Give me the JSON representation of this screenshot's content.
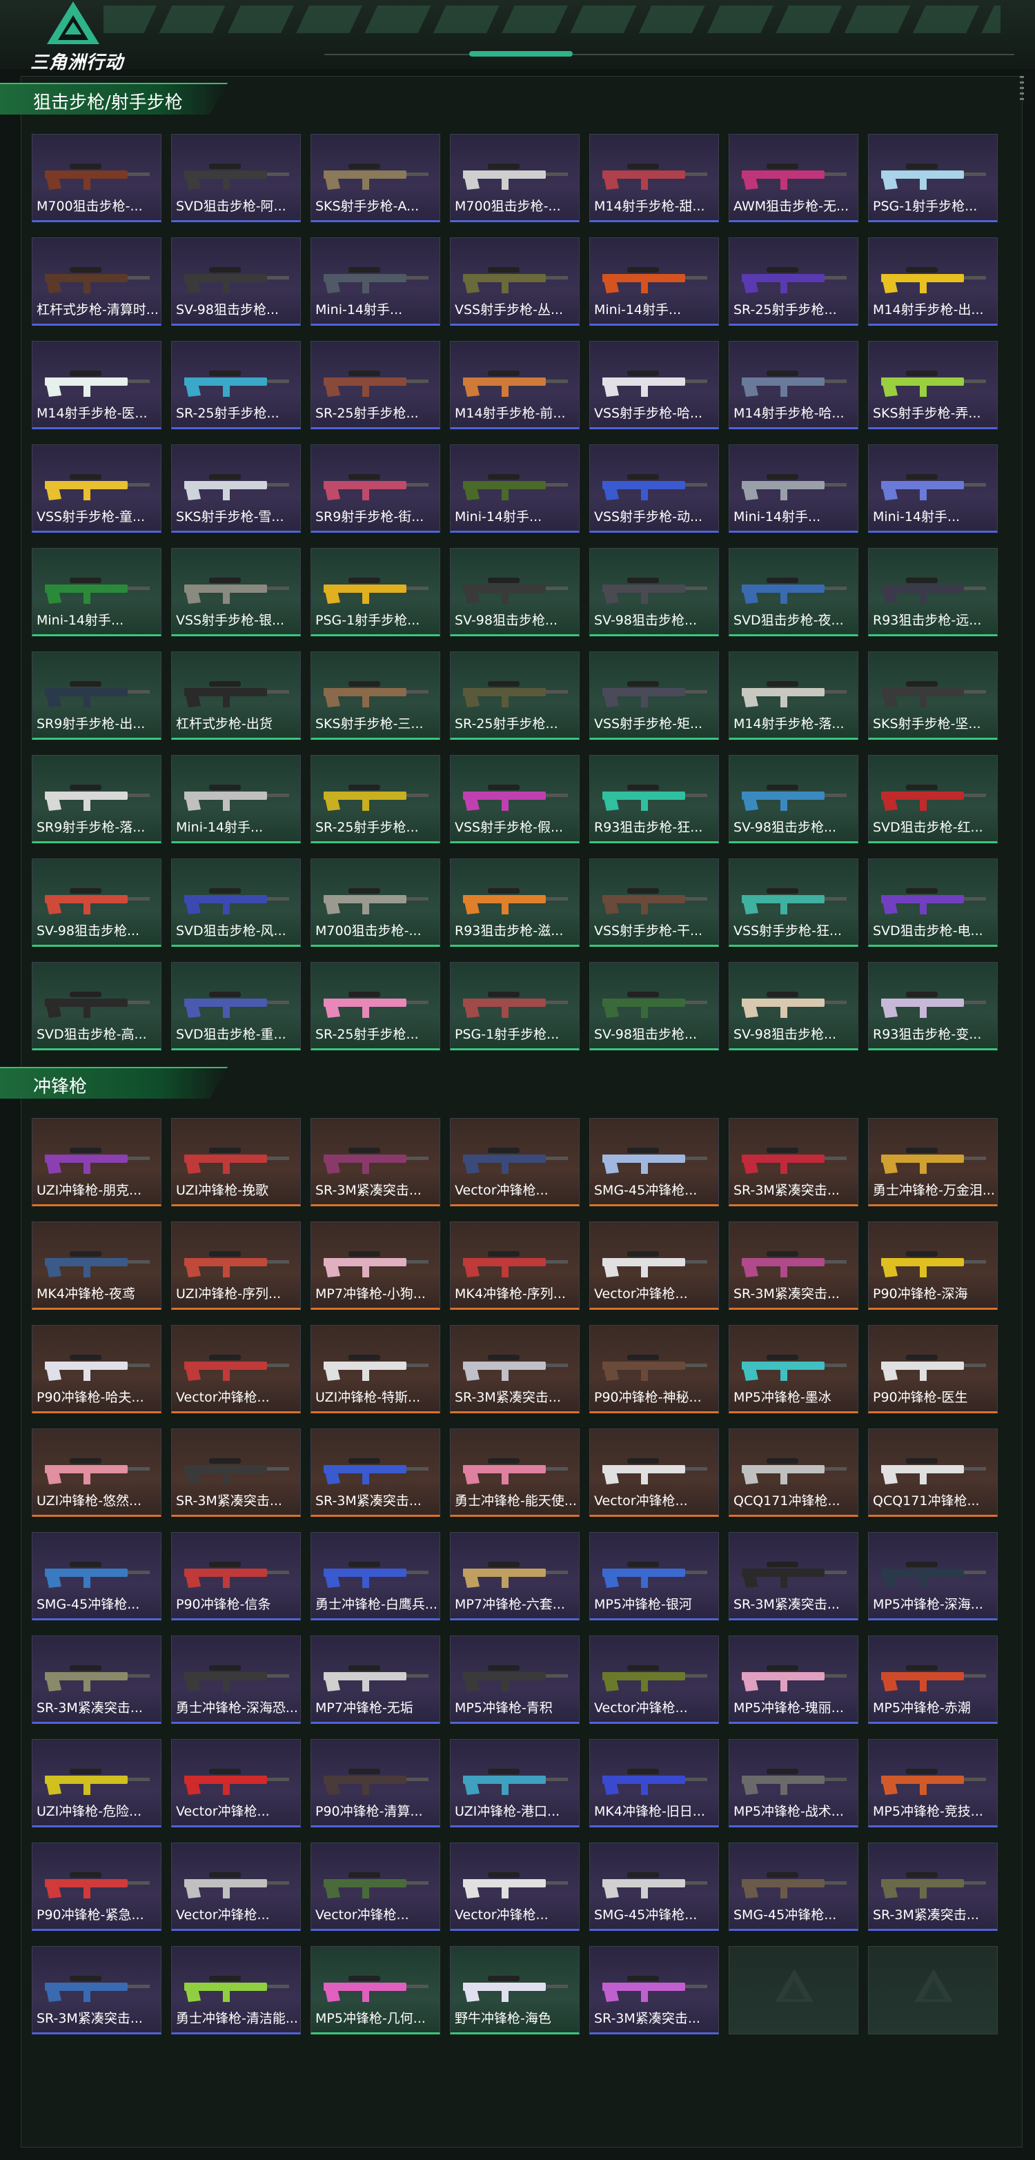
{
  "app": {
    "logo_text": "三角洲行动"
  },
  "sections": [
    {
      "title": "狙击步枪/射手步枪",
      "cards": [
        {
          "label": "M700狙击步枪-...",
          "rarity": "purple",
          "gun": "#7a3a26"
        },
        {
          "label": "SVD狙击步枪-阿...",
          "rarity": "purple",
          "gun": "#3c3c3c"
        },
        {
          "label": "SKS射手步枪-A...",
          "rarity": "purple",
          "gun": "#8a7a5a"
        },
        {
          "label": "M700狙击步枪-...",
          "rarity": "purple",
          "gun": "#cfcfcf"
        },
        {
          "label": "M14射手步枪-甜...",
          "rarity": "purple",
          "gun": "#b0404c"
        },
        {
          "label": "AWM狙击步枪-无...",
          "rarity": "purple",
          "gun": "#c0357a"
        },
        {
          "label": "PSG-1射手步枪...",
          "rarity": "purple",
          "gun": "#a8d3e8"
        },
        {
          "label": "杠杆式步枪-清算时...",
          "rarity": "purple",
          "gun": "#5c3a2a"
        },
        {
          "label": "SV-98狙击步枪...",
          "rarity": "purple",
          "gun": "#3a3a3a"
        },
        {
          "label": "Mini-14射手...",
          "rarity": "purple",
          "gun": "#505a66"
        },
        {
          "label": "VSS射手步枪-丛...",
          "rarity": "purple",
          "gun": "#6a6a3a"
        },
        {
          "label": "Mini-14射手...",
          "rarity": "purple",
          "gun": "#d4531f"
        },
        {
          "label": "SR-25射手步枪...",
          "rarity": "purple",
          "gun": "#5a3ab0"
        },
        {
          "label": "M14射手步枪-出...",
          "rarity": "purple",
          "gun": "#e8c020"
        },
        {
          "label": "M14射手步枪-医...",
          "rarity": "purple",
          "gun": "#e6f0ec"
        },
        {
          "label": "SR-25射手步枪...",
          "rarity": "purple",
          "gun": "#3aa8c8"
        },
        {
          "label": "SR-25射手步枪...",
          "rarity": "purple",
          "gun": "#8a4a3a"
        },
        {
          "label": "M14射手步枪-前...",
          "rarity": "purple",
          "gun": "#d07a3a"
        },
        {
          "label": "VSS射手步枪-哈...",
          "rarity": "purple",
          "gun": "#e0e0e6"
        },
        {
          "label": "M14射手步枪-哈...",
          "rarity": "purple",
          "gun": "#6a7a9a"
        },
        {
          "label": "SKS射手步枪-弄...",
          "rarity": "purple",
          "gun": "#9ad040"
        },
        {
          "label": "VSS射手步枪-童...",
          "rarity": "purple",
          "gun": "#e8c030"
        },
        {
          "label": "SKS射手步枪-雪...",
          "rarity": "purple",
          "gun": "#cfd4dc"
        },
        {
          "label": "SR9射手步枪-街...",
          "rarity": "purple",
          "gun": "#c04a6a"
        },
        {
          "label": "Mini-14射手...",
          "rarity": "purple",
          "gun": "#4a6a2a"
        },
        {
          "label": "VSS射手步枪-动...",
          "rarity": "purple",
          "gun": "#3a5ad0"
        },
        {
          "label": "Mini-14射手...",
          "rarity": "purple",
          "gun": "#9aa0aa"
        },
        {
          "label": "Mini-14射手...",
          "rarity": "purple",
          "gun": "#6a7ad8"
        },
        {
          "label": "Mini-14射手...",
          "rarity": "green",
          "gun": "#2a8a3a"
        },
        {
          "label": "VSS射手步枪-银...",
          "rarity": "green",
          "gun": "#8a8a80"
        },
        {
          "label": "PSG-1射手步枪...",
          "rarity": "green",
          "gun": "#e0b020"
        },
        {
          "label": "SV-98狙击步枪...",
          "rarity": "green",
          "gun": "#3a3a3a"
        },
        {
          "label": "SV-98狙击步枪...",
          "rarity": "green",
          "gun": "#4a4a52"
        },
        {
          "label": "SVD狙击步枪-夜...",
          "rarity": "green",
          "gun": "#3a6ab0"
        },
        {
          "label": "R93狙击步枪-远...",
          "rarity": "green",
          "gun": "#3a3a4a"
        },
        {
          "label": "SR9射手步枪-出...",
          "rarity": "green",
          "gun": "#2a3a4a"
        },
        {
          "label": "杠杆式步枪-出货",
          "rarity": "green",
          "gun": "#2a2a2a"
        },
        {
          "label": "SKS射手步枪-三...",
          "rarity": "green",
          "gun": "#8a6a4a"
        },
        {
          "label": "SR-25射手步枪...",
          "rarity": "green",
          "gun": "#5a5a3a"
        },
        {
          "label": "VSS射手步枪-矩...",
          "rarity": "green",
          "gun": "#4a4a5a"
        },
        {
          "label": "M14射手步枪-落...",
          "rarity": "green",
          "gun": "#c8c8c0"
        },
        {
          "label": "SKS射手步枪-坚...",
          "rarity": "green",
          "gun": "#3a3a3a"
        },
        {
          "label": "SR9射手步枪-落...",
          "rarity": "green",
          "gun": "#d8d8d8"
        },
        {
          "label": "Mini-14射手...",
          "rarity": "green",
          "gun": "#c0c0c0"
        },
        {
          "label": "SR-25射手步枪...",
          "rarity": "green",
          "gun": "#c8b020"
        },
        {
          "label": "VSS射手步枪-假...",
          "rarity": "green",
          "gun": "#c040b0"
        },
        {
          "label": "R93狙击步枪-狂...",
          "rarity": "green",
          "gun": "#30c0a0"
        },
        {
          "label": "SV-98狙击步枪...",
          "rarity": "green",
          "gun": "#3a8ac0"
        },
        {
          "label": "SVD狙击步枪-红...",
          "rarity": "green",
          "gun": "#c02a2a"
        },
        {
          "label": "SV-98狙击步枪...",
          "rarity": "green",
          "gun": "#d04a3a"
        },
        {
          "label": "SVD狙击步枪-风...",
          "rarity": "green",
          "gun": "#3a4ab0"
        },
        {
          "label": "M700狙击步枪-...",
          "rarity": "green",
          "gun": "#9a9a90"
        },
        {
          "label": "R93狙击步枪-滋...",
          "rarity": "green",
          "gun": "#e0802a"
        },
        {
          "label": "VSS射手步枪-干...",
          "rarity": "green",
          "gun": "#6a4a3a"
        },
        {
          "label": "VSS射手步枪-狂...",
          "rarity": "green",
          "gun": "#40b0a0"
        },
        {
          "label": "SVD狙击步枪-电...",
          "rarity": "green",
          "gun": "#7040c0"
        },
        {
          "label": "SVD狙击步枪-高...",
          "rarity": "green",
          "gun": "#2a2a2a"
        },
        {
          "label": "SVD狙击步枪-重...",
          "rarity": "green",
          "gun": "#4a5ab0"
        },
        {
          "label": "SR-25射手步枪...",
          "rarity": "green",
          "gun": "#e888b8"
        },
        {
          "label": "PSG-1射手步枪...",
          "rarity": "green",
          "gun": "#a04a4a"
        },
        {
          "label": "SV-98狙击步枪...",
          "rarity": "green",
          "gun": "#3a6a3a"
        },
        {
          "label": "SV-98狙击步枪...",
          "rarity": "green",
          "gun": "#d8c8b0"
        },
        {
          "label": "R93狙击步枪-变...",
          "rarity": "green",
          "gun": "#c8b8d8"
        }
      ]
    },
    {
      "title": "冲锋枪",
      "cards": [
        {
          "label": "UZI冲锋枪-朋克...",
          "rarity": "orange",
          "gun": "#8a40b0"
        },
        {
          "label": "UZI冲锋枪-挽歌",
          "rarity": "orange",
          "gun": "#c03a3a"
        },
        {
          "label": "SR-3M紧凑突击...",
          "rarity": "orange",
          "gun": "#8a3a6a"
        },
        {
          "label": "Vector冲锋枪...",
          "rarity": "orange",
          "gun": "#3a4a7a"
        },
        {
          "label": "SMG-45冲锋枪...",
          "rarity": "orange",
          "gun": "#a0b8e0"
        },
        {
          "label": "SR-3M紧凑突击...",
          "rarity": "orange",
          "gun": "#c02a3a"
        },
        {
          "label": "勇士冲锋枪-万金泪...",
          "rarity": "orange",
          "gun": "#d0a030"
        },
        {
          "label": "MK4冲锋枪-夜鸢",
          "rarity": "orange",
          "gun": "#3a5a8a"
        },
        {
          "label": "UZI冲锋枪-序列...",
          "rarity": "orange",
          "gun": "#c04a3a"
        },
        {
          "label": "MP7冲锋枪-小狗...",
          "rarity": "orange",
          "gun": "#e0b0c0"
        },
        {
          "label": "MK4冲锋枪-序列...",
          "rarity": "orange",
          "gun": "#c03a3a"
        },
        {
          "label": "Vector冲锋枪...",
          "rarity": "orange",
          "gun": "#e0e0e0"
        },
        {
          "label": "SR-3M紧凑突击...",
          "rarity": "orange",
          "gun": "#b04a8a"
        },
        {
          "label": "P90冲锋枪-深海",
          "rarity": "orange",
          "gun": "#e0c020"
        },
        {
          "label": "P90冲锋枪-哈夫...",
          "rarity": "orange",
          "gun": "#e0e0e8"
        },
        {
          "label": "Vector冲锋枪...",
          "rarity": "orange",
          "gun": "#c03a3a"
        },
        {
          "label": "UZI冲锋枪-特斯...",
          "rarity": "orange",
          "gun": "#e0e0e0"
        },
        {
          "label": "SR-3M紧凑突击...",
          "rarity": "orange",
          "gun": "#c0c0c8"
        },
        {
          "label": "P90冲锋枪-神秘...",
          "rarity": "orange",
          "gun": "#6a4a3a"
        },
        {
          "label": "MP5冲锋枪-墨冰",
          "rarity": "orange",
          "gun": "#40c0c0"
        },
        {
          "label": "P90冲锋枪-医生",
          "rarity": "orange",
          "gun": "#e0e0e0"
        },
        {
          "label": "UZI冲锋枪-悠然...",
          "rarity": "orange",
          "gun": "#e090a0"
        },
        {
          "label": "SR-3M紧凑突击...",
          "rarity": "orange",
          "gun": "#3a3a3a"
        },
        {
          "label": "SR-3M紧凑突击...",
          "rarity": "orange",
          "gun": "#3a5ad0"
        },
        {
          "label": "勇士冲锋枪-能天使...",
          "rarity": "orange",
          "gun": "#e080a0"
        },
        {
          "label": "Vector冲锋枪...",
          "rarity": "orange",
          "gun": "#e0e0e0"
        },
        {
          "label": "QCQ171冲锋枪...",
          "rarity": "orange",
          "gun": "#c0c0c0"
        },
        {
          "label": "QCQ171冲锋枪...",
          "rarity": "orange",
          "gun": "#e0e0e0"
        },
        {
          "label": "SMG-45冲锋枪...",
          "rarity": "purple",
          "gun": "#3a7ac0"
        },
        {
          "label": "P90冲锋枪-信条",
          "rarity": "purple",
          "gun": "#c03a3a"
        },
        {
          "label": "勇士冲锋枪-白鹰兵...",
          "rarity": "purple",
          "gun": "#3a5ad0"
        },
        {
          "label": "MP7冲锋枪-六套...",
          "rarity": "purple",
          "gun": "#c0a060"
        },
        {
          "label": "MP5冲锋枪-银河",
          "rarity": "purple",
          "gun": "#3a6ad0"
        },
        {
          "label": "SR-3M紧凑突击...",
          "rarity": "purple",
          "gun": "#2a2a2a"
        },
        {
          "label": "MP5冲锋枪-深海...",
          "rarity": "purple",
          "gun": "#2a3a4a"
        },
        {
          "label": "SR-3M紧凑突击...",
          "rarity": "purple",
          "gun": "#8a8a6a"
        },
        {
          "label": "勇士冲锋枪-深海恐...",
          "rarity": "purple",
          "gun": "#3a3a3a"
        },
        {
          "label": "MP7冲锋枪-无垢",
          "rarity": "purple",
          "gun": "#d0d0d0"
        },
        {
          "label": "MP5冲锋枪-青积",
          "rarity": "purple",
          "gun": "#3a3a3a"
        },
        {
          "label": "Vector冲锋枪...",
          "rarity": "purple",
          "gun": "#6a7a2a"
        },
        {
          "label": "MP5冲锋枪-瑰丽...",
          "rarity": "purple",
          "gun": "#e0a0c0"
        },
        {
          "label": "MP5冲锋枪-赤潮",
          "rarity": "purple",
          "gun": "#d04a2a"
        },
        {
          "label": "UZI冲锋枪-危险...",
          "rarity": "purple",
          "gun": "#d0c020"
        },
        {
          "label": "Vector冲锋枪...",
          "rarity": "purple",
          "gun": "#d02a2a"
        },
        {
          "label": "P90冲锋枪-清算...",
          "rarity": "purple",
          "gun": "#4a3a3a"
        },
        {
          "label": "UZI冲锋枪-港口...",
          "rarity": "purple",
          "gun": "#40a0c0"
        },
        {
          "label": "MK4冲锋枪-旧日...",
          "rarity": "purple",
          "gun": "#3a4ad0"
        },
        {
          "label": "MP5冲锋枪-战术...",
          "rarity": "purple",
          "gun": "#6a6a6a"
        },
        {
          "label": "MP5冲锋枪-竞技...",
          "rarity": "purple",
          "gun": "#d05a2a"
        },
        {
          "label": "P90冲锋枪-紧急...",
          "rarity": "purple",
          "gun": "#d03a3a"
        },
        {
          "label": "Vector冲锋枪...",
          "rarity": "purple",
          "gun": "#c0c0c0"
        },
        {
          "label": "Vector冲锋枪...",
          "rarity": "purple",
          "gun": "#4a6a3a"
        },
        {
          "label": "Vector冲锋枪...",
          "rarity": "purple",
          "gun": "#e0e0e0"
        },
        {
          "label": "SMG-45冲锋枪...",
          "rarity": "purple",
          "gun": "#d0d0d0"
        },
        {
          "label": "SMG-45冲锋枪...",
          "rarity": "purple",
          "gun": "#6a5a4a"
        },
        {
          "label": "SR-3M紧凑突击...",
          "rarity": "purple",
          "gun": "#6a6a4a"
        },
        {
          "label": "SR-3M紧凑突击...",
          "rarity": "purple",
          "gun": "#3a6ab0"
        },
        {
          "label": "勇士冲锋枪-清洁能...",
          "rarity": "purple",
          "gun": "#90d040"
        },
        {
          "label": "MP5冲锋枪-几何...",
          "rarity": "green",
          "gun": "#e060c0"
        },
        {
          "label": "野牛冲锋枪-海色",
          "rarity": "green",
          "gun": "#e0e0f0"
        },
        {
          "label": "SR-3M紧凑突击...",
          "rarity": "purple",
          "gun": "#c060d0"
        },
        {
          "label": "",
          "rarity": "empty",
          "gun": ""
        },
        {
          "label": "",
          "rarity": "empty",
          "gun": ""
        }
      ]
    }
  ],
  "colors": {
    "accent": "#35c16b",
    "purple_border": "#4f63d9",
    "green_border": "#38c77d",
    "orange_border": "#d9722a"
  }
}
